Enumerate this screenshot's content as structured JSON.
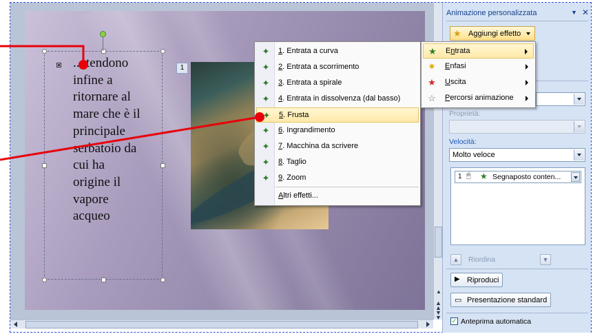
{
  "slide": {
    "text_lines": "... tendono\ninfine a\nritornare al\nmare che è il\nprincipale\nserbatoio da\ncui ha\norigine il\nvapore\nacqueo",
    "order_tag": "1"
  },
  "effects_menu": {
    "items": [
      {
        "label": "1. Entrata a curva",
        "key": "1",
        "rest": ". Entrata a curva"
      },
      {
        "label": "2. Entrata a scorrimento",
        "key": "2",
        "rest": ". Entrata a scorrimento"
      },
      {
        "label": "3. Entrata a spirale",
        "key": "3",
        "rest": ". Entrata a spirale"
      },
      {
        "label": "4. Entrata in dissolvenza (dal basso)",
        "key": "4",
        "rest": ". Entrata in dissolvenza (dal basso)"
      },
      {
        "label": "5. Frusta",
        "key": "5",
        "rest": ". Frusta"
      },
      {
        "label": "6. Ingrandimento",
        "key": "6",
        "rest": ". Ingrandimento"
      },
      {
        "label": "7. Macchina da scrivere",
        "key": "7",
        "rest": ". Macchina da scrivere"
      },
      {
        "label": "8. Taglio",
        "key": "8",
        "rest": ". Taglio"
      },
      {
        "label": "9. Zoom",
        "key": "9",
        "rest": ". Zoom"
      }
    ],
    "more": {
      "key": "A",
      "rest": "ltri effetti..."
    }
  },
  "category_menu": {
    "items": [
      {
        "key": "n",
        "pre": "E",
        "rest": "trata"
      },
      {
        "key": "E",
        "pre": "",
        "rest": "nfasi"
      },
      {
        "key": "U",
        "pre": "",
        "rest": "scita"
      },
      {
        "key": "P",
        "pre": "",
        "rest": "ercorsi animazione"
      }
    ]
  },
  "pane": {
    "title": "Animazione personalizzata",
    "add_effect": "Aggiungi effetto",
    "properties_label": "Proprietà:",
    "speed_label": "Velocità:",
    "speed_value": "Molto veloce",
    "list_item_number": "1",
    "list_item_text": "Segnaposto conten...",
    "reorder": "Riordina",
    "play": "Riproduci",
    "slideshow": "Presentazione standard",
    "auto_preview": "Anteprima automatica"
  },
  "colors": {
    "accent_highlight": "#ffe9a8",
    "callout": "#e8000a",
    "pane_bg": "#d6e3f5"
  }
}
